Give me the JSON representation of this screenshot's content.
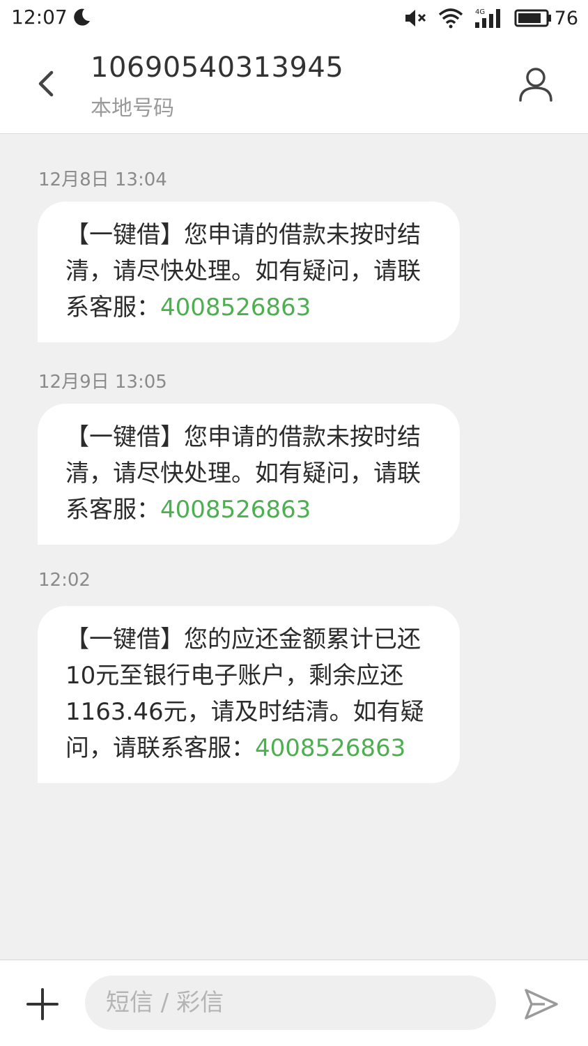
{
  "status_bar": {
    "time": "12:07",
    "network_label": "4G",
    "battery_level": "76",
    "icons": [
      "moon-icon",
      "mute-icon",
      "wifi-icon",
      "signal-4g-icon",
      "battery-icon"
    ]
  },
  "header": {
    "contact_number": "10690540313945",
    "contact_subtitle": "本地号码",
    "icons": [
      "back-icon",
      "contact-icon"
    ]
  },
  "messages": [
    {
      "timestamp": "12月8日 13:04",
      "text": "【一键借】您申请的借款未按时结清，请尽快处理。如有疑问，请联系客服：",
      "phone": "4008526863"
    },
    {
      "timestamp": "12月9日 13:05",
      "text": "【一键借】您申请的借款未按时结清，请尽快处理。如有疑问，请联系客服：",
      "phone": "4008526863"
    },
    {
      "timestamp": "12:02",
      "text": "【一键借】您的应还金额累计已还10元至银行电子账户，剩余应还1163.46元，请及时结清。如有疑问，请联系客服：",
      "phone": "4008526863"
    }
  ],
  "composer": {
    "placeholder": "短信 / 彩信",
    "icons": [
      "add-icon",
      "send-icon"
    ]
  },
  "colors": {
    "link": "#4caf50",
    "background": "#f0f0f0",
    "bubble": "#ffffff"
  }
}
